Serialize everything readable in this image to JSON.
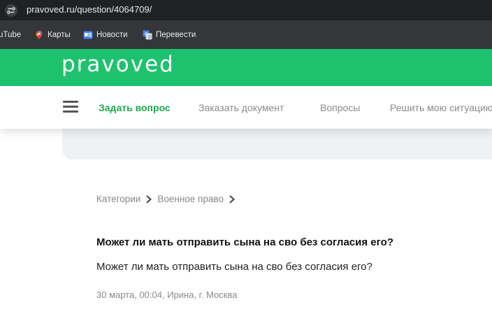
{
  "browser": {
    "url": "pravoved.ru/question/4064709/",
    "bookmarks": [
      {
        "label": "uTube",
        "icon": "youtube-icon"
      },
      {
        "label": "Карты",
        "icon": "maps-pin-icon"
      },
      {
        "label": "Новости",
        "icon": "news-icon"
      },
      {
        "label": "Перевести",
        "icon": "translate-icon"
      }
    ]
  },
  "header": {
    "logo": "pravoved",
    "brand_color": "#1ec26e"
  },
  "nav": {
    "items": [
      {
        "label": "Задать вопрос"
      },
      {
        "label": "Заказать документ"
      },
      {
        "label": "Вопросы"
      },
      {
        "label": "Решить мою ситуацию"
      }
    ]
  },
  "breadcrumb": {
    "items": [
      "Категории",
      "Военное право"
    ]
  },
  "question": {
    "title": "Может ли мать отправить сына на сво без согласия его?",
    "body": "Может ли мать отправить сына на сво без согласия его?",
    "meta": "30 марта, 00:04, Ирина, г. Москва"
  }
}
